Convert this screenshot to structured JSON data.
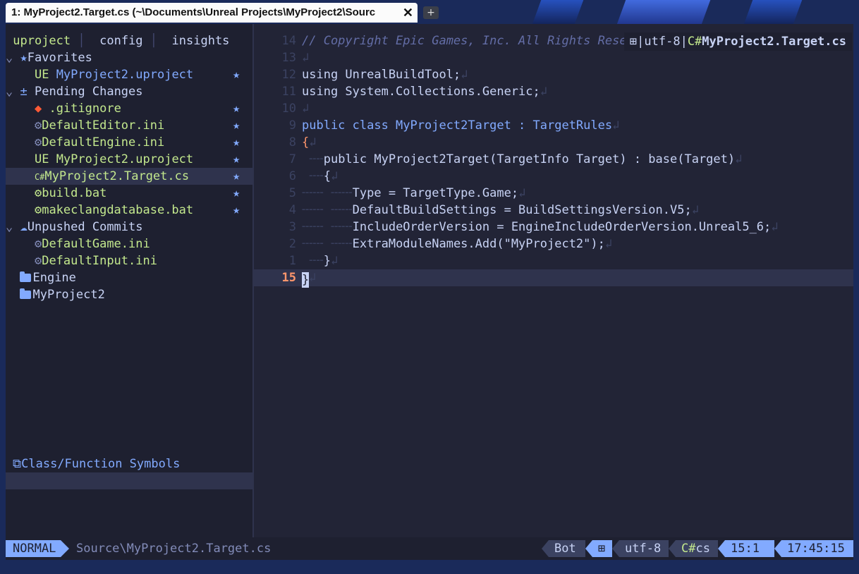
{
  "window": {
    "tab_title": "1: MyProject2.Target.cs (~\\Documents\\Unreal Projects\\MyProject2\\Sourc",
    "close_glyph": "✕",
    "new_tab_glyph": "+"
  },
  "sidebar": {
    "tabs": [
      "uproject",
      "config",
      "insights"
    ],
    "favorites_label": "Favorites",
    "favorites": [
      "MyProject2.uproject"
    ],
    "pending_label": "Pending Changes",
    "pending": [
      {
        "name": ".gitignore",
        "icon": "git-icon"
      },
      {
        "name": "DefaultEditor.ini",
        "icon": "gear-icon"
      },
      {
        "name": "DefaultEngine.ini",
        "icon": "gear-icon"
      },
      {
        "name": "MyProject2.uproject",
        "icon": "ue-icon"
      },
      {
        "name": "MyProject2.Target.cs",
        "icon": "csharp-icon"
      },
      {
        "name": "build.bat",
        "icon": "gear-icon"
      },
      {
        "name": "makeclangdatabase.bat",
        "icon": "gear-icon"
      }
    ],
    "unpushed_label": "Unpushed Commits",
    "unpushed": [
      "DefaultGame.ini",
      "DefaultInput.ini"
    ],
    "folders": [
      "Engine",
      "MyProject2"
    ],
    "ue_prefix": "UE",
    "symbols_label": "Class/Function Symbols"
  },
  "editor": {
    "winbar_encoding": "utf-8",
    "winbar_filename": "MyProject2.Target.cs",
    "lines": [
      {
        "num": "14",
        "text": "// Copyright Epic Games, Inc. All Rights Rese"
      },
      {
        "num": "13",
        "text": ""
      },
      {
        "num": "12",
        "text": "using UnrealBuildTool;"
      },
      {
        "num": "11",
        "text": "using System.Collections.Generic;"
      },
      {
        "num": "10",
        "text": ""
      },
      {
        "num": "9",
        "text": "public class MyProject2Target : TargetRules"
      },
      {
        "num": "8",
        "text": "{"
      },
      {
        "num": "7",
        "text": "public MyProject2Target(TargetInfo Target) : base(Target)"
      },
      {
        "num": "6",
        "text": "{"
      },
      {
        "num": "5",
        "text": "Type = TargetType.Game;"
      },
      {
        "num": "4",
        "text": "DefaultBuildSettings = BuildSettingsVersion.V5;"
      },
      {
        "num": "3",
        "text": "IncludeOrderVersion = EngineIncludeOrderVersion.Unreal5_6;"
      },
      {
        "num": "2",
        "text": "ExtraModuleNames.Add(\"MyProject2\");"
      },
      {
        "num": "1",
        "text": "}"
      },
      {
        "num": "15",
        "text": "}"
      }
    ]
  },
  "statusline": {
    "mode": "NORMAL",
    "path": "Source\\MyProject2.Target.cs",
    "position": "Bot",
    "encoding": "utf-8",
    "filetype": "cs",
    "cursor": "15:1",
    "time": "17:45:15"
  },
  "colors": {
    "accent": "#82aaff",
    "green": "#c3e88d",
    "orange": "#ff966c",
    "background": "#222436"
  }
}
